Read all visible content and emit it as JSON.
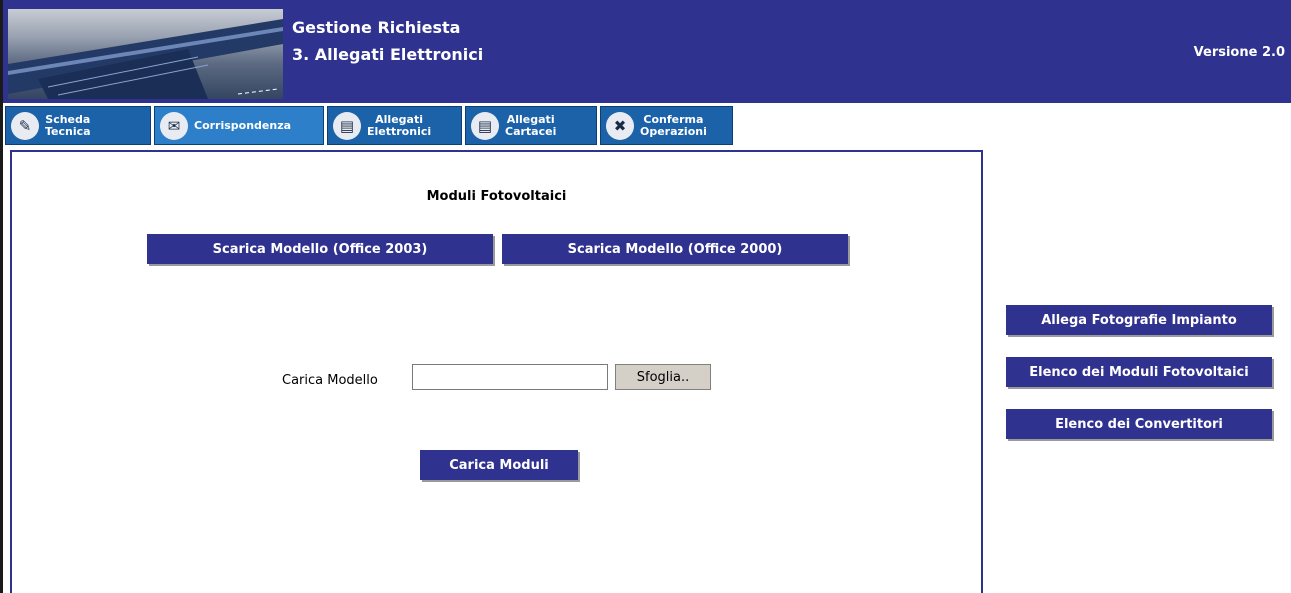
{
  "header": {
    "title_line1": "Gestione Richiesta",
    "title_line2": "3. Allegati Elettronici",
    "version": "Versione 2.0"
  },
  "tabs": [
    {
      "label_line1": "Scheda",
      "label_line2": "Tecnica",
      "icon": "pen-icon"
    },
    {
      "label_line1": "Corrispondenza",
      "label_line2": "",
      "icon": "envelope-icon"
    },
    {
      "label_line1": "Allegati",
      "label_line2": "Elettronici",
      "icon": "document-icon"
    },
    {
      "label_line1": "Allegati",
      "label_line2": "Cartacei",
      "icon": "document-icon"
    },
    {
      "label_line1": "Conferma",
      "label_line2": "Operazioni",
      "icon": "tools-icon"
    }
  ],
  "main": {
    "title": "Moduli Fotovoltaici",
    "download_2003": "Scarica Modello (Office 2003)",
    "download_2000": "Scarica Modello (Office 2000)",
    "upload_label": "Carica Modello",
    "file_value": "",
    "browse_label": "Sfoglia..",
    "upload_button": "Carica Moduli"
  },
  "side": {
    "photos_button": "Allega Fotografie Impianto",
    "modules_button": "Elenco dei Moduli Fotovoltaici",
    "converters_button": "Elenco dei Convertitori"
  },
  "colors": {
    "header_bg": "#303290",
    "tab_bg": "#1b62a8",
    "button_bg": "#303290"
  }
}
